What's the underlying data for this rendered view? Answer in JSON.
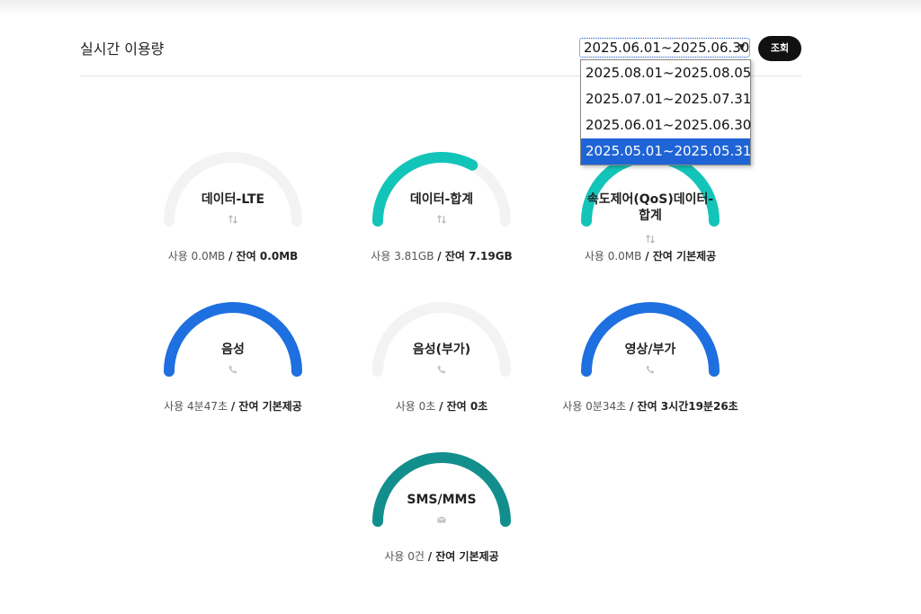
{
  "header": {
    "title": "실시간 이용량",
    "period_selected": "2025.06.01~2025.06.30",
    "search_label": "조회"
  },
  "dropdown": {
    "options": [
      "2025.08.01~2025.08.05",
      "2025.07.01~2025.07.31",
      "2025.06.01~2025.06.30",
      "2025.05.01~2025.05.31"
    ],
    "highlighted_index": 3
  },
  "gauges": [
    {
      "label": "데이터-LTE",
      "icon": "data-arrows-icon",
      "used_prefix": "사용",
      "used": "0.0MB",
      "sep": "/",
      "rem_prefix": "잔여",
      "remaining": "0.0MB",
      "fill": 0.0,
      "color": "#1e6fe0"
    },
    {
      "label": "데이터-합계",
      "icon": "data-arrows-icon",
      "used_prefix": "사용",
      "used": "3.81GB",
      "sep": "/",
      "rem_prefix": "잔여",
      "remaining": "7.19GB",
      "fill": 0.66,
      "color": "#13c4b9"
    },
    {
      "label": "속도제어(QoS)데이터-합계",
      "label_lines": [
        "속도제어(QoS)데이터-",
        "합계"
      ],
      "icon": "data-arrows-icon",
      "used_prefix": "사용",
      "used": "0.0MB",
      "sep": "/",
      "rem_prefix": "잔여",
      "remaining": "기본제공",
      "fill": 1.0,
      "color": "#13c4b9"
    },
    {
      "label": "음성",
      "icon": "phone-icon",
      "used_prefix": "사용",
      "used": "4분47초",
      "sep": "/",
      "rem_prefix": "잔여",
      "remaining": "기본제공",
      "fill": 1.0,
      "color": "#1e6fe0"
    },
    {
      "label": "음성(부가)",
      "icon": "phone-icon",
      "used_prefix": "사용",
      "used": "0초",
      "sep": "/",
      "rem_prefix": "잔여",
      "remaining": "0초",
      "fill": 0.0,
      "color": "#1e6fe0"
    },
    {
      "label": "영상/부가",
      "icon": "phone-icon",
      "used_prefix": "사용",
      "used": "0분34초",
      "sep": "/",
      "rem_prefix": "잔여",
      "remaining": "3시간19분26초",
      "fill": 1.0,
      "color": "#1e6fe0"
    },
    {
      "label": "SMS/MMS",
      "icon": "mail-icon",
      "used_prefix": "사용",
      "used": "0건",
      "sep": "/",
      "rem_prefix": "잔여",
      "remaining": "기본제공",
      "fill": 1.0,
      "color": "#128f8c"
    }
  ]
}
